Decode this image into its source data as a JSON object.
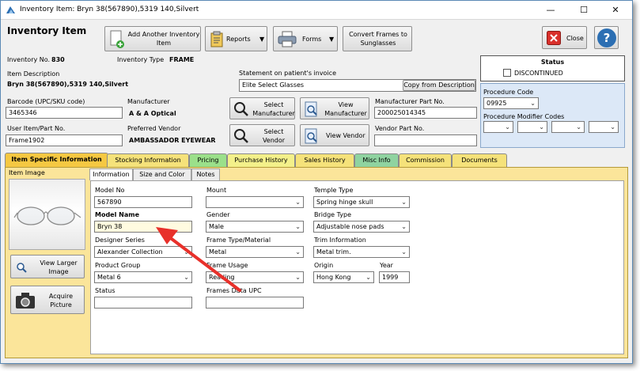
{
  "window": {
    "title": "Inventory Item:  Bryn 38(567890),5319 140,Silvert",
    "minimize": "—",
    "maximize": "☐",
    "close": "✕"
  },
  "header": {
    "title": "Inventory Item"
  },
  "toolbar": {
    "add_another": "Add Another Inventory Item",
    "reports": "Reports",
    "forms": "Forms",
    "convert": "Convert Frames to Sunglasses",
    "close": "Close",
    "help": "?"
  },
  "item": {
    "inventory_no_label": "Inventory No.",
    "inventory_no": "830",
    "inventory_type_label": "Inventory Type",
    "inventory_type": "FRAME",
    "description_label": "Item Description",
    "description": "Bryn 38(567890),5319 140,Silvert",
    "statement_label": "Statement on patient's invoice",
    "statement": "Elite Select Glasses",
    "copy_desc": "Copy from Description",
    "barcode_label": "Barcode (UPC/SKU code)",
    "barcode": "3465346",
    "manufacturer_label": "Manufacturer",
    "manufacturer": "A & A Optical",
    "user_item_label": "User Item/Part No.",
    "user_item": "Frame1902",
    "vendor_label": "Preferred Vendor",
    "vendor": "AMBASSADOR EYEWEAR",
    "select_manufacturer": "Select Manufacturer",
    "view_manufacturer": "View Manufacturer",
    "select_vendor": "Select Vendor",
    "view_vendor": "View Vendor",
    "mfr_part_label": "Manufacturer Part No.",
    "mfr_part": "200025014345",
    "vendor_part_label": "Vendor Part No.",
    "vendor_part": ""
  },
  "status": {
    "title": "Status",
    "discontinued": "DISCONTINUED",
    "procedure_code_label": "Procedure Code",
    "procedure_code": "09925",
    "modifier_label": "Procedure Modifier Codes"
  },
  "tabs": [
    {
      "label": "Item Specific Information",
      "color": "#f5c842"
    },
    {
      "label": "Stocking Information",
      "color": "#f5e27a"
    },
    {
      "label": "Pricing",
      "color": "#9be08a"
    },
    {
      "label": "Purchase History",
      "color": "#f3f08a"
    },
    {
      "label": "Sales History",
      "color": "#f5e27a"
    },
    {
      "label": "Misc Info",
      "color": "#8fd3a0"
    },
    {
      "label": "Commission",
      "color": "#f5e27a"
    },
    {
      "label": "Documents",
      "color": "#f5e27a"
    }
  ],
  "left_panel": {
    "item_image_label": "Item Image",
    "view_larger": "View Larger Image",
    "acquire": "Acquire Picture"
  },
  "inner_tabs": [
    "Information",
    "Size and Color",
    "Notes"
  ],
  "info": {
    "model_no_label": "Model No",
    "model_no": "567890",
    "model_name_label": "Model Name",
    "model_name": "Bryn 38",
    "designer_label": "Designer Series",
    "designer": "Alexander Collection",
    "product_group_label": "Product Group",
    "product_group": "Metal 6",
    "status_label": "Status",
    "status": "",
    "mount_label": "Mount",
    "mount": "",
    "gender_label": "Gender",
    "gender": "Male",
    "frame_type_label": "Frame Type/Material",
    "frame_type": "Metal",
    "frame_usage_label": "Frame Usage",
    "frame_usage": "Reading",
    "frames_upc_label": "Frames Data UPC",
    "frames_upc": "",
    "temple_label": "Temple Type",
    "temple": "Spring hinge skull",
    "bridge_label": "Bridge Type",
    "bridge": "Adjustable nose pads",
    "trim_label": "Trim Information",
    "trim": "Metal trim.",
    "origin_label": "Origin",
    "origin": "Hong Kong",
    "year_label": "Year",
    "year": "1999"
  }
}
